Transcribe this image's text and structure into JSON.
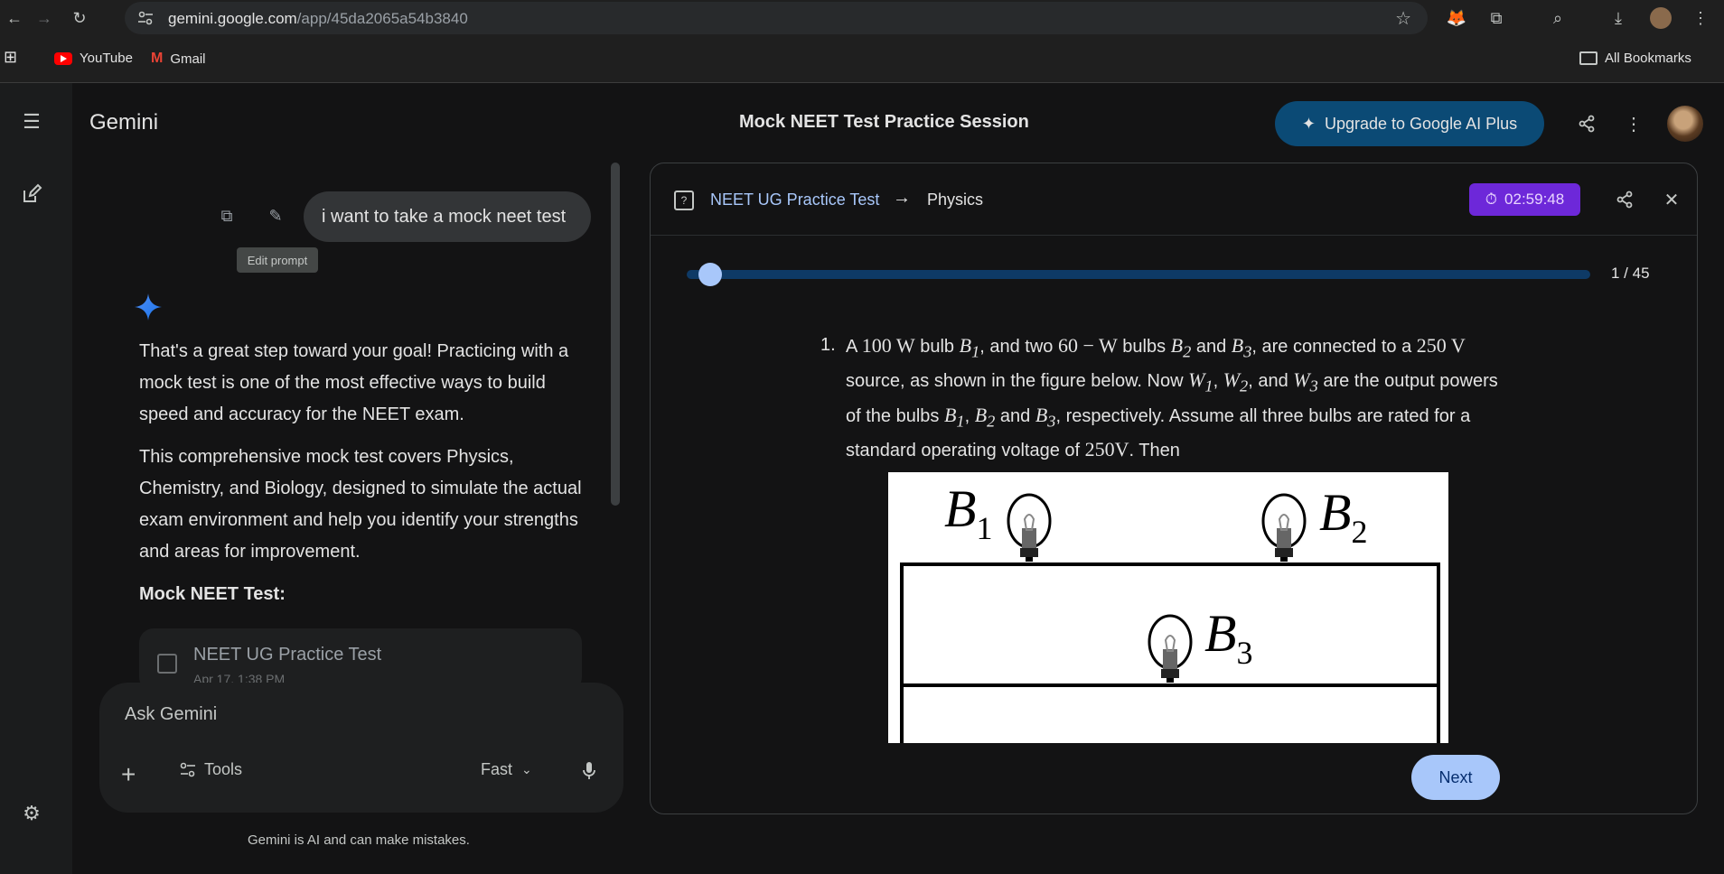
{
  "browser": {
    "url_domain": "gemini.google.com",
    "url_path": "/app/45da2065a54b3840",
    "bookmarks": [
      {
        "label": "YouTube",
        "icon": "youtube-icon"
      },
      {
        "label": "Gmail",
        "icon": "gmail-icon"
      }
    ],
    "all_bookmarks_label": "All Bookmarks"
  },
  "header": {
    "brand": "Gemini",
    "session_title": "Mock NEET Test Practice Session",
    "upgrade_label": "Upgrade to Google AI Plus"
  },
  "chat": {
    "user_message": "i want to take a mock neet test",
    "edit_tooltip": "Edit prompt",
    "reply_paragraphs": [
      "That's a great step toward your goal! Practicing with a mock test is one of the most effective ways to build speed and accuracy for the NEET exam.",
      "This comprehensive mock test covers Physics, Chemistry, and Biology, designed to simulate the actual exam environment and help you identify your strengths and areas for improvement."
    ],
    "reply_heading": "Mock NEET Test:",
    "card_title": "NEET UG Practice Test",
    "card_subtitle": "Apr 17, 1:38 PM"
  },
  "composer": {
    "placeholder": "Ask Gemini",
    "tools_label": "Tools",
    "mode_label": "Fast",
    "disclaimer": "Gemini is AI and can make mistakes."
  },
  "canvas": {
    "breadcrumb_root": "NEET UG Practice Test",
    "breadcrumb_current": "Physics",
    "timer": "02:59:48",
    "progress_label": "1 / 45",
    "progress_fraction": 0.022,
    "next_label": "Next",
    "question": {
      "number": "1.",
      "t1": "A ",
      "m1": "100 W",
      "t2": " bulb ",
      "t3": ", and two ",
      "m2": "60 − W",
      "t4": " bulbs ",
      "t5": " and ",
      "t6": ", are connected to a ",
      "m3": "250 V",
      "t7": " source, as shown in the figure below. Now ",
      "t8": ", ",
      "t9": ", and ",
      "t10": " are the output powers of the bulbs ",
      "t11": ", ",
      "t12": " and ",
      "t13": ", respectively. Assume all three bulbs are rated for a standard operating voltage of ",
      "m4": "250V",
      "t14": ". Then"
    },
    "figure_labels": {
      "b1": "B",
      "b1_sub": "1",
      "b2": "B",
      "b2_sub": "2",
      "b3": "B",
      "b3_sub": "3"
    }
  },
  "colors": {
    "accent_blue": "#a8c7fa",
    "upgrade_bg": "#0b4a75",
    "timer_bg": "#6d28d9",
    "background": "#131314"
  }
}
